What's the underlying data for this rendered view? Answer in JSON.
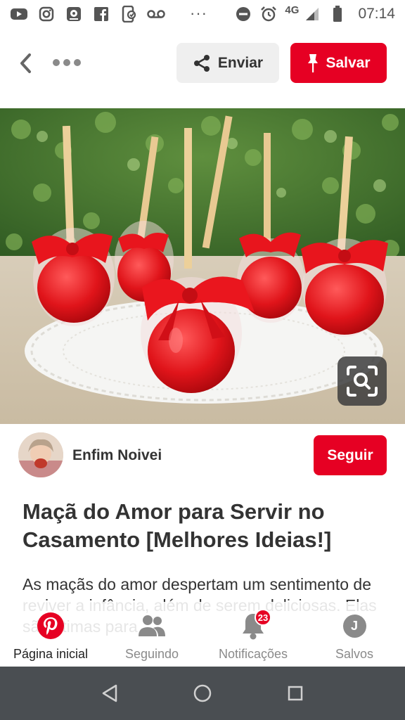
{
  "status_bar": {
    "icons": [
      "youtube-icon",
      "instagram-icon",
      "photo-icon",
      "facebook-icon",
      "phone-app-icon",
      "voicemail-icon"
    ],
    "more": "···",
    "network": "4G",
    "time": "07:14"
  },
  "top_bar": {
    "send_label": "Enviar",
    "save_label": "Salvar"
  },
  "author": {
    "name": "Enfim Noivei",
    "follow_label": "Seguir"
  },
  "pin": {
    "title": "Maçã do Amor para Servir no Casamento [Melhores Ideias!]",
    "description": "As maçãs do amor despertam um sentimento de reviver a infância, além de serem deliciosas. Elas são ótimas para"
  },
  "bottom_nav": {
    "items": [
      {
        "label": "Página inicial",
        "icon": "pinterest-logo-icon",
        "active": true
      },
      {
        "label": "Seguindo",
        "icon": "people-icon",
        "active": false
      },
      {
        "label": "Notificações",
        "icon": "bell-icon",
        "badge": "23",
        "active": false
      },
      {
        "label": "Salvos",
        "icon": "profile-avatar-icon",
        "avatar_letter": "J",
        "active": false
      }
    ]
  },
  "colors": {
    "brand_red": "#e60023",
    "grey_text": "#8a8a8a",
    "android_bar": "#4a4e52"
  }
}
